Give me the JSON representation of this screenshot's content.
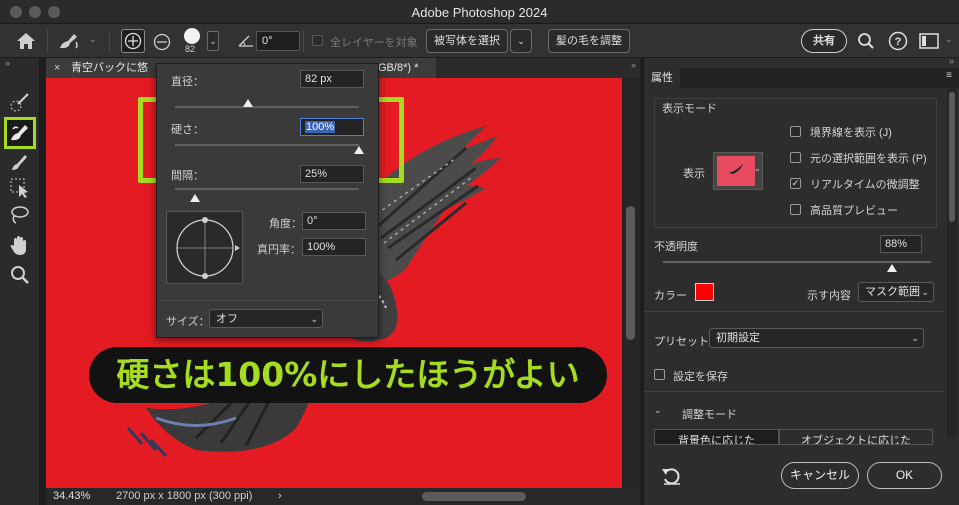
{
  "window": {
    "title": "Adobe Photoshop 2024"
  },
  "options_bar": {
    "brush_size": "82",
    "angle": "0°",
    "all_layers_label": "全レイヤーを対象",
    "select_subject_label": "被写体を選択",
    "refine_hair_label": "髪の毛を調整",
    "share_label": "共有"
  },
  "document": {
    "tab_title": "青空バックに悠",
    "tab_suffix": "GB/8*) *",
    "zoom": "34.43%",
    "dimensions": "2700 px x 1800 px (300 ppi)"
  },
  "brush_popup": {
    "diameter_label": "直径：",
    "diameter_value": "82 px",
    "hardness_label": "硬さ：",
    "hardness_value": "100%",
    "spacing_label": "間隔：",
    "spacing_value": "25%",
    "angle_label": "角度：",
    "angle_value": "0°",
    "roundness_label": "真円率：",
    "roundness_value": "100%",
    "size_label": "サイズ：",
    "size_value": "オフ"
  },
  "annotation": {
    "caption": "硬さは100%にしたほうがよい",
    "highlight_color": "#a6dc1e"
  },
  "properties_panel": {
    "tab": "属性",
    "view_mode_heading": "表示モード",
    "view_label": "表示",
    "checkboxes": [
      {
        "label": "境界線を表示 (J)",
        "checked": false
      },
      {
        "label": "元の選択範囲を表示 (P)",
        "checked": false
      },
      {
        "label": "リアルタイムの微調整",
        "checked": true
      },
      {
        "label": "高品質プレビュー",
        "checked": false
      }
    ],
    "opacity_label": "不透明度",
    "opacity_value": "88%",
    "opacity_level": 0.88,
    "color_label": "カラー",
    "color_value": "#ff0000",
    "shows_label": "示す内容",
    "shows_value": "マスク範囲",
    "preset_label": "プリセット",
    "preset_value": "初期設定",
    "save_settings_label": "設定を保存",
    "adjust_mode_label": "調整モード",
    "mode_button_1": "背景色に応じた",
    "mode_button_2": "オブジェクトに応じた",
    "cancel_label": "キャンセル",
    "ok_label": "OK"
  }
}
